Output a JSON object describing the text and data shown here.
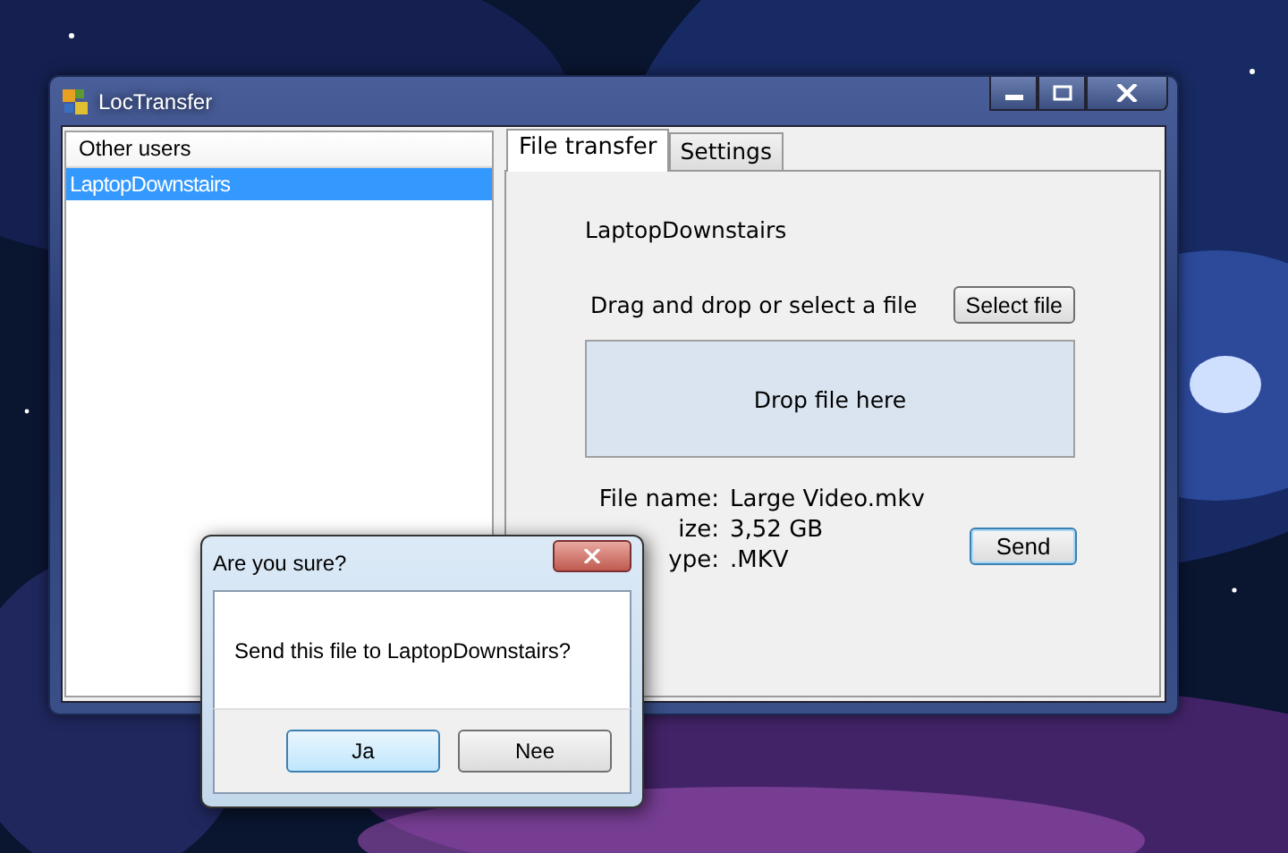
{
  "window": {
    "title": "LocTransfer",
    "users_list": {
      "header": "Other users",
      "items": [
        {
          "label": "LaptopDownstairs",
          "selected": true
        }
      ]
    },
    "tabs": [
      {
        "label": "File transfer",
        "selected": true
      },
      {
        "label": "Settings",
        "selected": false
      }
    ],
    "target_user": "LaptopDownstairs",
    "drop_prompt": "Drag and drop or select a file",
    "select_button": "Select file",
    "drop_zone": "Drop file here",
    "file_info": [
      {
        "label": "File name:",
        "value": "Large Video.mkv"
      },
      {
        "label": "ize:",
        "value": "3,52 GB"
      },
      {
        "label": "ype:",
        "value": ".MKV"
      }
    ],
    "send_button": "Send"
  },
  "dialog": {
    "title": "Are you sure?",
    "message": "Send this file to LaptopDownstairs?",
    "buttons": [
      {
        "label": "Ja",
        "focused": true
      },
      {
        "label": "Nee",
        "focused": false
      }
    ]
  }
}
